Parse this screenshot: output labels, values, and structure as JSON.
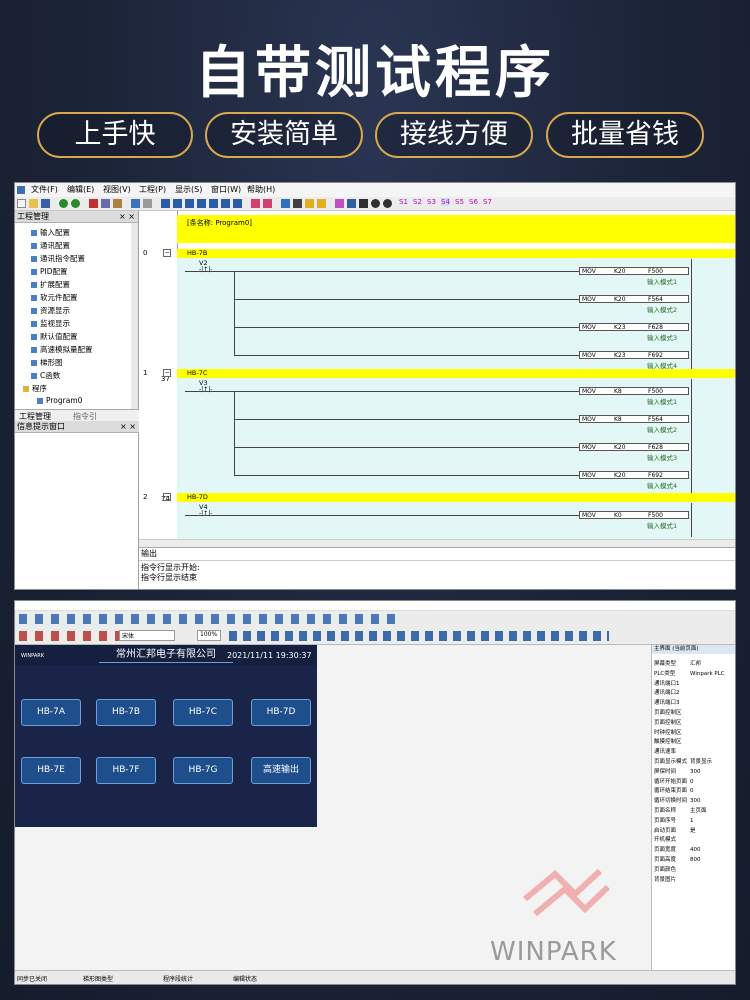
{
  "headline": "自带测试程序",
  "features": [
    "上手快",
    "安装简单",
    "接线方便",
    "批量省钱"
  ],
  "plc": {
    "menu": [
      "文件(F)",
      "编辑(E)",
      "视图(V)",
      "工程(P)",
      "显示(S)",
      "窗口(W)",
      "帮助(H)"
    ],
    "toolbar_tags": [
      "S1",
      "S2",
      "S3",
      "S4",
      "S5",
      "S6",
      "S7"
    ],
    "project_panel_title": "工程管理",
    "tree_items": [
      "输入配置",
      "通讯配置",
      "通讯指令配置",
      "PID配置",
      "扩展配置",
      "软元件配置",
      "资源显示",
      "监视显示",
      "默认值配置",
      "高速模拟量配置",
      "梯形图",
      "C函数",
      "程序",
      "Program0"
    ],
    "tabs": [
      "工程管理",
      "指令引"
    ],
    "info_panel_title": "信息提示窗口",
    "header_comment": "[条名称: Program0]",
    "rungs": [
      {
        "num": "0",
        "label": "HB-7B",
        "contact": "V2",
        "end": "37",
        "outputs": [
          {
            "op": "MOV",
            "a": "K20",
            "b": "F500",
            "c": "输入模式1"
          },
          {
            "op": "MOV",
            "a": "K20",
            "b": "F564",
            "c": "输入模式2"
          },
          {
            "op": "MOV",
            "a": "K23",
            "b": "F628",
            "c": "输入模式3"
          },
          {
            "op": "MOV",
            "a": "K23",
            "b": "F692",
            "c": "输入模式4"
          }
        ]
      },
      {
        "num": "1",
        "label": "HB-7C",
        "contact": "V3",
        "end": "74",
        "outputs": [
          {
            "op": "MOV",
            "a": "K8",
            "b": "F500",
            "c": "输入模式1"
          },
          {
            "op": "MOV",
            "a": "K8",
            "b": "F564",
            "c": "输入模式2"
          },
          {
            "op": "MOV",
            "a": "K20",
            "b": "F628",
            "c": "输入模式3"
          },
          {
            "op": "MOV",
            "a": "K20",
            "b": "F692",
            "c": "输入模式4"
          }
        ]
      },
      {
        "num": "2",
        "label": "HB-7D",
        "contact": "V4",
        "end": "",
        "outputs": [
          {
            "op": "MOV",
            "a": "K0",
            "b": "F500",
            "c": "输入模式1"
          }
        ]
      }
    ],
    "contact_mark": "-|↑|-",
    "output_title": "输出",
    "output_lines": [
      "指令行显示开始:",
      "指令行显示结束"
    ]
  },
  "hmi": {
    "company": "常州汇邦电子有限公司",
    "datetime": "2021/11/11  19:30:37",
    "logo": "WINPARK",
    "buttons": [
      "HB-7A",
      "HB-7B",
      "HB-7C",
      "HB-7D",
      "HB-7E",
      "HB-7F",
      "HB-7G",
      "高速输出"
    ],
    "font_field": "宋体",
    "zoom": "100%",
    "panel_title": "主界面 (当前页面)",
    "props": [
      "屏幕类型",
      "PLC类型",
      "通讯端口1",
      "通讯端口2",
      "通讯端口3",
      "页面控制区",
      "页面控制区",
      "时钟控制区",
      "触摸控制区",
      "通讯速率",
      "页面显示模式",
      "屏保时间",
      "循环开始页面",
      "循环结束页面",
      "循环切换时间",
      "页面名称",
      "页面序号",
      "启动页面",
      "开机模式",
      "页面宽度",
      "页面高度",
      "页面颜色",
      "背景图片"
    ],
    "prop_values": [
      "汇邦",
      "Winpark PLC",
      "",
      "",
      "",
      "",
      "",
      "",
      "",
      "",
      "背景显示",
      "300",
      "0",
      "0",
      "300",
      "主页面",
      "1",
      "是",
      "",
      "400",
      "800",
      "",
      ""
    ],
    "watermark": "WINPARK",
    "status_items": [
      "同步已关闭",
      "梯形图类型",
      "程序段统计",
      "编辑状态"
    ]
  },
  "colors": {
    "accent": "#d9a84e",
    "ladder_bar": "#ffff00",
    "hmi_bg": "#1a2448",
    "hmi_button": "#1e4f8c"
  }
}
